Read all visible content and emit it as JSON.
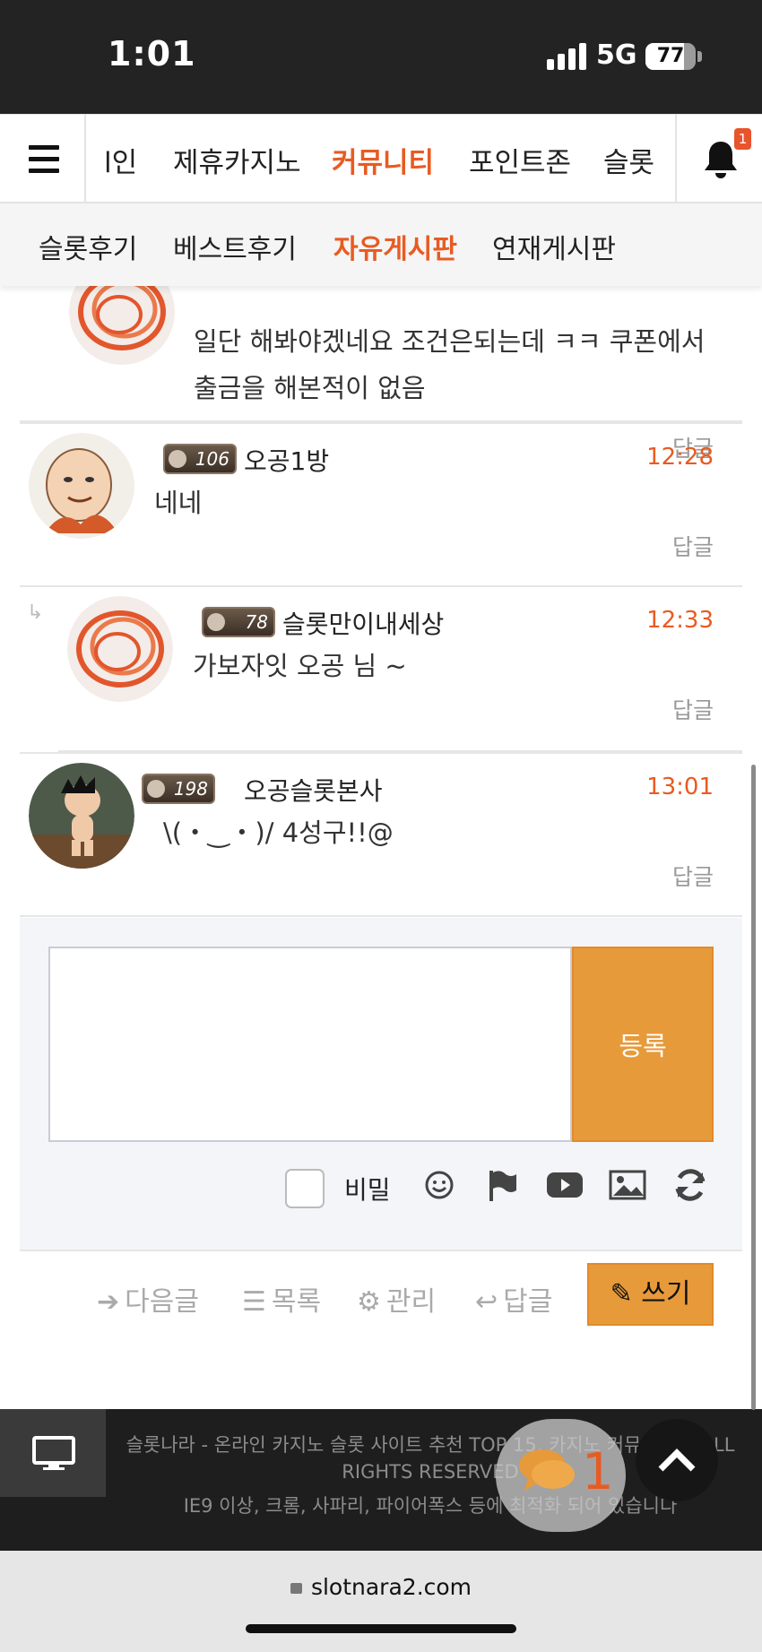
{
  "status_bar": {
    "time": "1:01",
    "network": "5G",
    "battery": "77",
    "battery_level": 0.77
  },
  "main_nav": {
    "items": [
      {
        "label": "l인",
        "active": false
      },
      {
        "label": "제휴카지노",
        "active": false
      },
      {
        "label": "커뮤니티",
        "active": true
      },
      {
        "label": "포인트존",
        "active": false
      },
      {
        "label": "슬롯",
        "active": false
      }
    ],
    "notification_count": "1"
  },
  "sub_nav": {
    "items": [
      {
        "label": "슬롯후기",
        "active": false
      },
      {
        "label": "베스트후기",
        "active": false
      },
      {
        "label": "자유게시판",
        "active": true
      },
      {
        "label": "연재게시판",
        "active": false
      }
    ]
  },
  "comments": [
    {
      "text_line1": "일단 해봐야겠네요 조건은되는데 ㅋㅋ 쿠폰에서",
      "text_line2": "출금을 해본적이 없음",
      "reply": "답글"
    },
    {
      "level": "106",
      "author": "오공1방",
      "time": "12:28",
      "text": "네네",
      "reply": "답글"
    },
    {
      "level": "78",
      "author": "슬롯만이내세상",
      "time": "12:33",
      "text": "가보자잇 오공 님 ~",
      "reply": "답글"
    },
    {
      "level": "198",
      "author": "오공슬롯본사",
      "time": "13:01",
      "text": "\\(・‿・)/ 4성구!!@",
      "reply": "답글"
    }
  ],
  "form": {
    "submit_label": "등록",
    "secret_label": "비밀"
  },
  "actions": {
    "next": "다음글",
    "list": "목록",
    "manage": "관리",
    "reply": "답글",
    "write": "쓰기"
  },
  "footer": {
    "line1": "슬롯나라 - 온라인 카지노 슬롯 사이트 추천 TOP 15, 카지노 커뮤니티 ©ALL",
    "line2": "RIGHTS RESERVED",
    "line3": "IE9 이상, 크롬, 사파리, 파이어폭스 등에 최적화 되어 있습니다",
    "chat_count": "1"
  },
  "browser": {
    "url": "slotnara2.com"
  },
  "colors": {
    "accent": "#e85b22",
    "button": "#e79a3a",
    "dark": "#1e1e1e"
  }
}
